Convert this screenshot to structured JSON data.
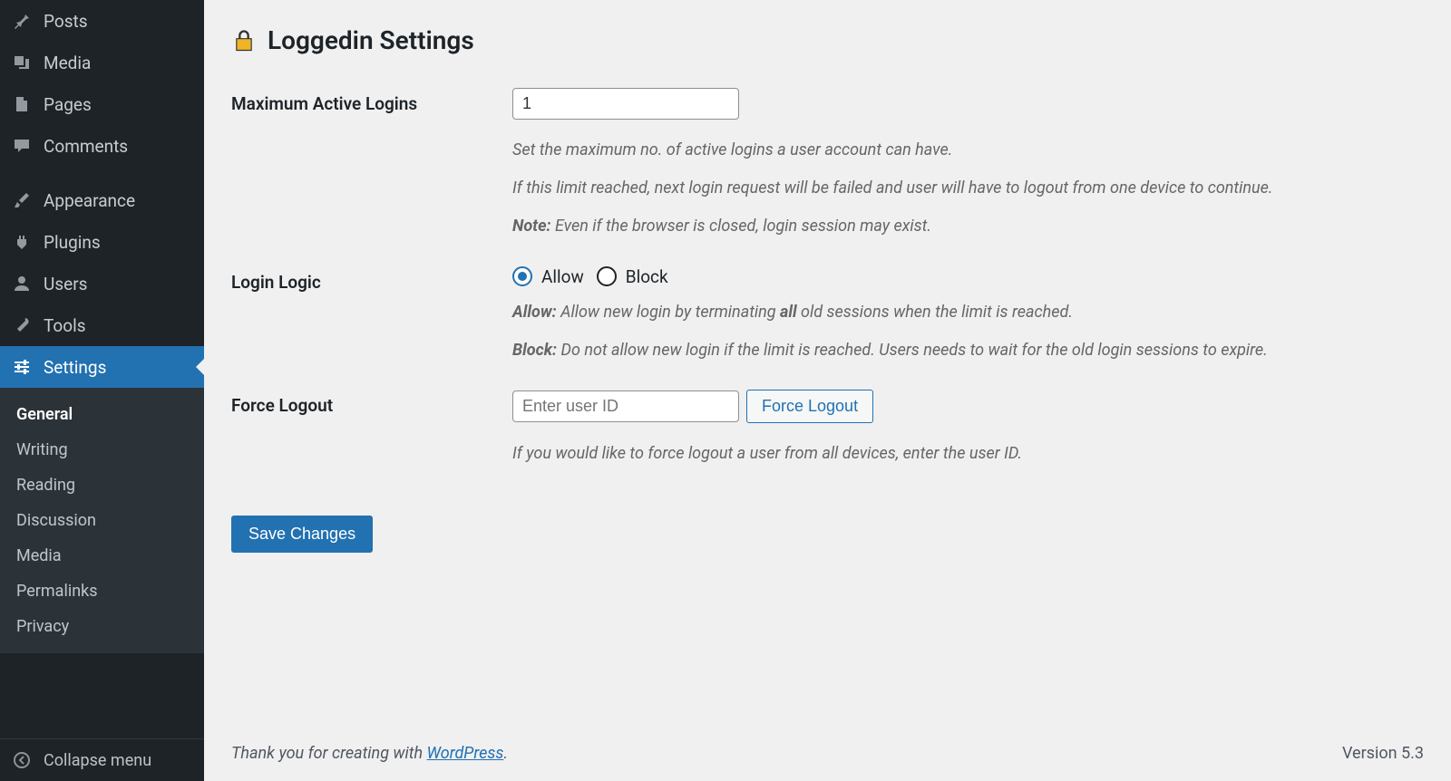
{
  "sidebar": {
    "items": [
      {
        "label": "Posts"
      },
      {
        "label": "Media"
      },
      {
        "label": "Pages"
      },
      {
        "label": "Comments"
      },
      {
        "label": "Appearance"
      },
      {
        "label": "Plugins"
      },
      {
        "label": "Users"
      },
      {
        "label": "Tools"
      },
      {
        "label": "Settings"
      }
    ],
    "submenu": [
      {
        "label": "General"
      },
      {
        "label": "Writing"
      },
      {
        "label": "Reading"
      },
      {
        "label": "Discussion"
      },
      {
        "label": "Media"
      },
      {
        "label": "Permalinks"
      },
      {
        "label": "Privacy"
      }
    ],
    "collapse": "Collapse menu"
  },
  "page": {
    "title": "Loggedin Settings",
    "fields": {
      "max_logins": {
        "label": "Maximum Active Logins",
        "value": "1",
        "desc1": "Set the maximum no. of active logins a user account can have.",
        "desc2": "If this limit reached, next login request will be failed and user will have to logout from one device to continue.",
        "note_label": "Note:",
        "note_text": " Even if the browser is closed, login session may exist."
      },
      "login_logic": {
        "label": "Login Logic",
        "allow_label": "Allow",
        "block_label": "Block",
        "selected": "allow",
        "allow_strong": "Allow:",
        "allow_mid1": " Allow new login by terminating ",
        "allow_strong2": "all",
        "allow_mid2": " old sessions when the limit is reached.",
        "block_strong": "Block:",
        "block_text": " Do not allow new login if the limit is reached. Users needs to wait for the old login sessions to expire."
      },
      "force_logout": {
        "label": "Force Logout",
        "placeholder": "Enter user ID",
        "button": "Force Logout",
        "desc": "If you would like to force logout a user from all devices, enter the user ID."
      }
    },
    "save_label": "Save Changes"
  },
  "footer": {
    "thanks_prefix": "Thank you for creating with ",
    "link_text": "WordPress",
    "thanks_suffix": ".",
    "version": "Version 5.3"
  }
}
